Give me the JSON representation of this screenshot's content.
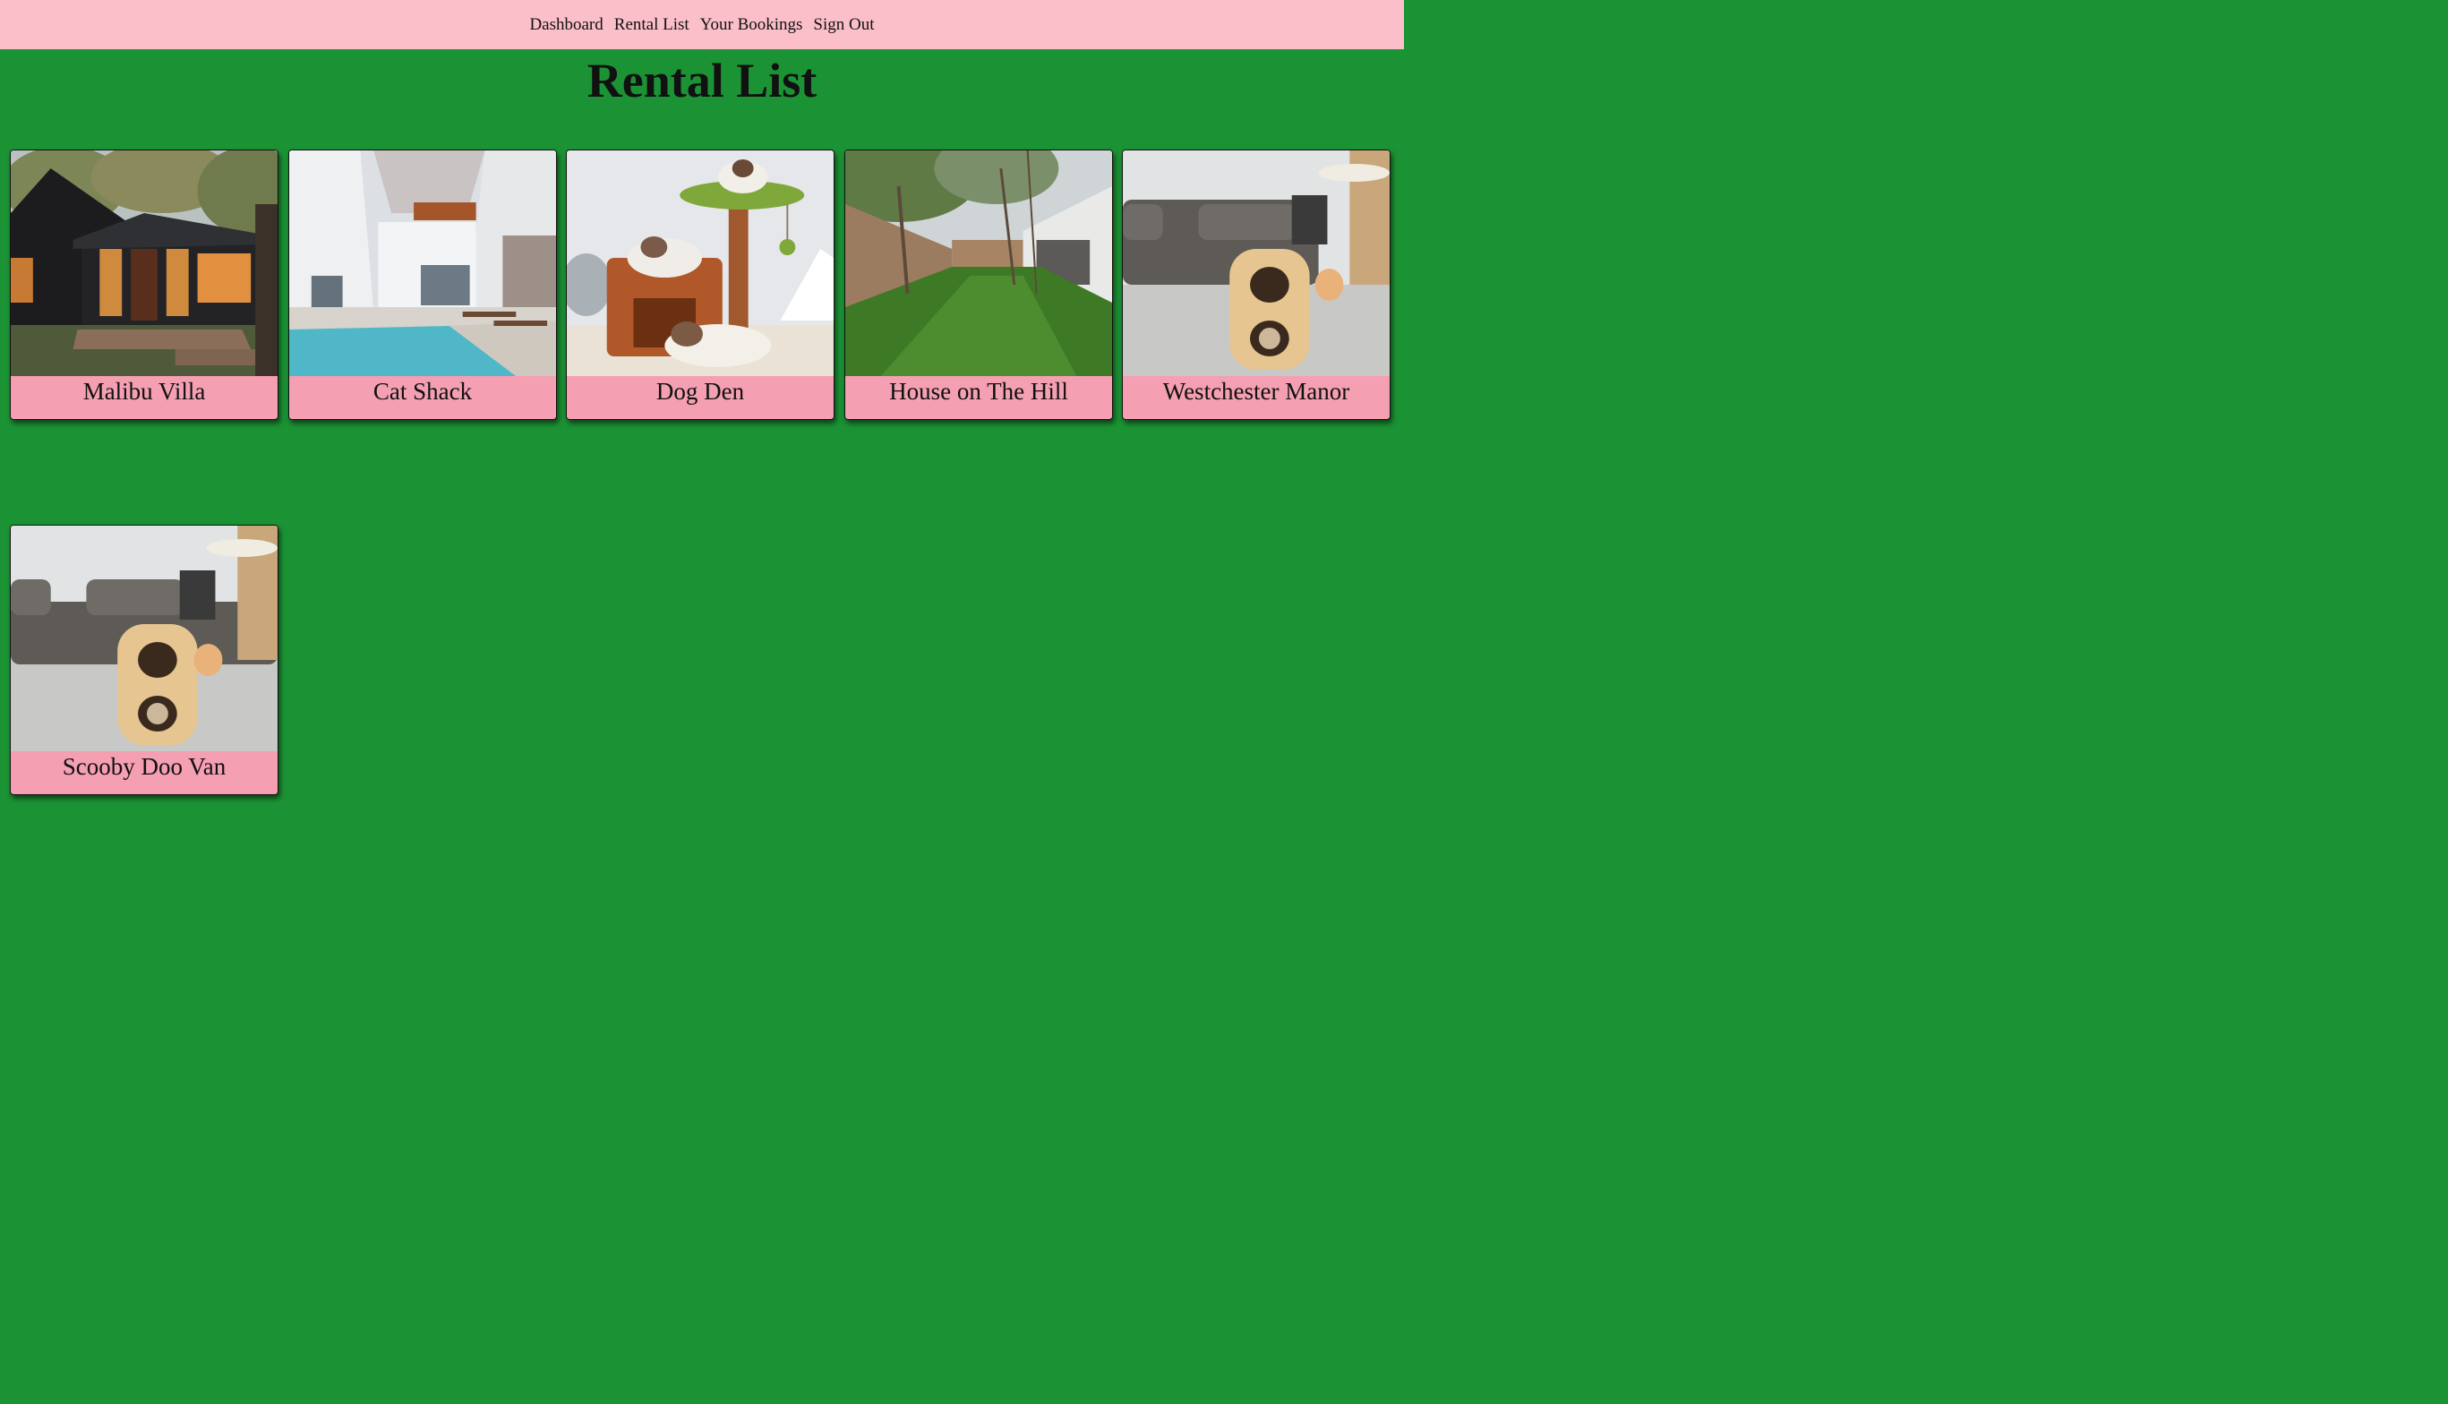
{
  "nav": {
    "items": [
      {
        "label": "Dashboard"
      },
      {
        "label": "Rental List"
      },
      {
        "label": "Your Bookings"
      },
      {
        "label": "Sign Out"
      }
    ]
  },
  "page": {
    "title": "Rental List"
  },
  "colors": {
    "background": "#1b9334",
    "nav_background": "#fbbfca",
    "card_label_background": "#f59fb3"
  },
  "rentals": [
    {
      "name": "Malibu Villa",
      "image": "dark-modern-house-photo"
    },
    {
      "name": "Cat Shack",
      "image": "white-villa-pool-photo"
    },
    {
      "name": "Dog Den",
      "image": "cat-tree-with-cats-photo"
    },
    {
      "name": "House on The Hill",
      "image": "green-backyard-lawn-photo"
    },
    {
      "name": "Westchester Manor",
      "image": "cat-condo-living-room-photo"
    },
    {
      "name": "Scooby Doo Van",
      "image": "cat-condo-living-room-photo"
    }
  ]
}
